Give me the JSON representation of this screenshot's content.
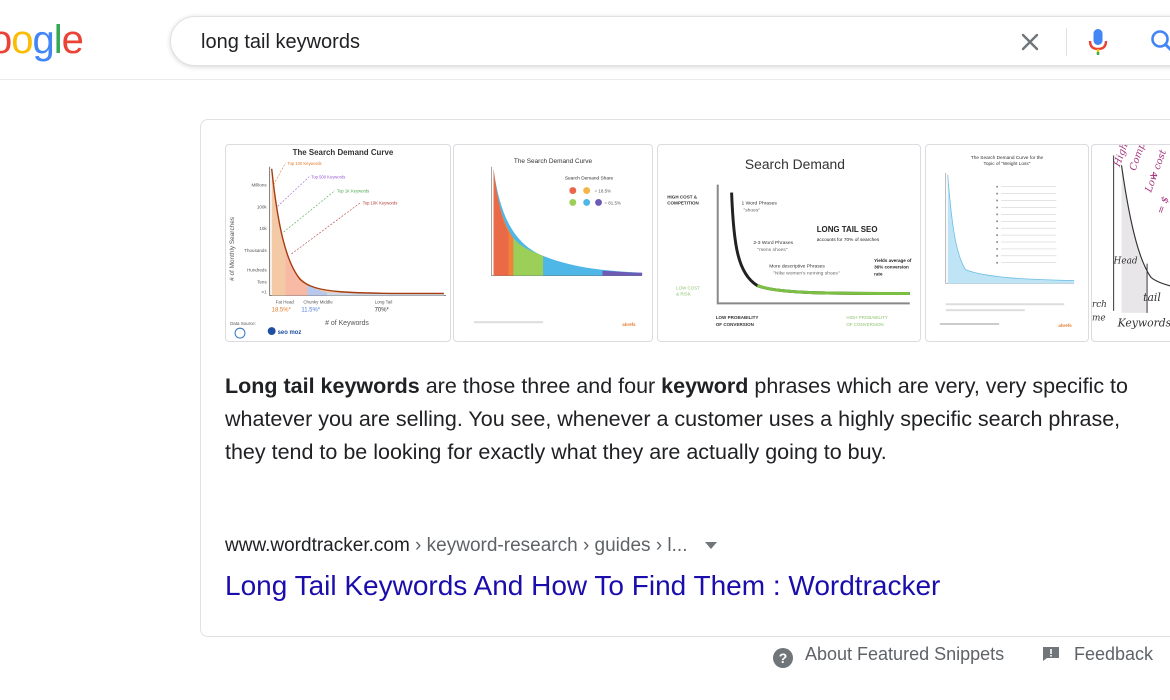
{
  "header": {
    "logo": {
      "letters": [
        "o",
        "o",
        "g",
        "l",
        "e"
      ],
      "colors": [
        "#ea4335",
        "#fbbc05",
        "#4285f4",
        "#34a853",
        "#ea4335"
      ]
    },
    "search": {
      "query": "long tail keywords"
    },
    "icons": {
      "clear": "close-icon",
      "mic": "microphone-icon",
      "search": "search-icon"
    }
  },
  "featured_snippet": {
    "images": [
      {
        "title": "The Search Demand Curve",
        "ylabel": "# of Monthly Searches",
        "xlabel": "# of Keywords",
        "y_ticks": [
          "Millions",
          "100k",
          "10k",
          "Thousands",
          "Hundreds",
          "Tens",
          "<1"
        ],
        "callouts": [
          "Top 100 Keywords",
          "Top 500 Keywords",
          "Top 1K Keywords",
          "Top 10K Keywords"
        ],
        "bottom_groups": [
          "Fat Head",
          "Chunky Middle",
          "Long Tail"
        ],
        "bottom_values": [
          "18.5%*",
          "11.5%*",
          "70%*"
        ],
        "source_label": "Data Source:",
        "logos": [
          "seo moz"
        ]
      },
      {
        "title": "The Search Demand Curve",
        "legend_title": "Search Demand Share",
        "legend_rows": [
          "= 18.5%",
          "= 81.5%"
        ],
        "footer_logo": "ahrefs"
      },
      {
        "title": "Search Demand",
        "left_label_top": [
          "HIGH COST &",
          "COMPETITION"
        ],
        "left_label_bottom": [
          "LOW COST",
          "& RISK"
        ],
        "bottom_left": [
          "LOW PROBABILITY",
          "OF CONVERSION"
        ],
        "bottom_right": [
          "HIGH PROBABILITY",
          "OF CONVERSION"
        ],
        "phrase1": [
          "1 Word Phrases",
          "\"shoes\""
        ],
        "phrase2": [
          "2-3 Word Phrases",
          "\"mens shoes\""
        ],
        "phrase3": [
          "More descriptive Phrases",
          "\"Nike women's running shoes\""
        ],
        "headline": "LONG TAIL SEO",
        "headline_sub": "accounts for 70% of searches",
        "yield": [
          "Yields average of",
          "36% conversion",
          "rate"
        ]
      },
      {
        "title": [
          "The Search Demand Curve for the",
          "Topic of \"Weight Loss\""
        ],
        "footer_logo": "ahrefs"
      },
      {
        "handwriting": [
          "High",
          "Competition",
          "+",
          "Low cost",
          "= $"
        ],
        "labels": [
          "Head",
          "tail",
          "rch",
          "me",
          "Keywords"
        ]
      }
    ],
    "text": {
      "t1": "Long tail keywords",
      "t2": " are those three and four ",
      "t3": "keyword",
      "t4": " phrases which are very, very specific to whatever you are selling. You see, whenever a customer uses a highly specific search phrase, they tend to be looking for exactly what they are actually going to buy."
    },
    "cite": {
      "domain": "www.wordtracker.com",
      "path": " › keyword-research › guides › l...",
      "menu_icon": "caret-down-icon"
    },
    "title": "Long Tail Keywords And How To Find Them : Wordtracker"
  },
  "footer": {
    "about": "About Featured Snippets",
    "about_icon": "help-icon",
    "feedback": "Feedback",
    "feedback_icon": "feedback-icon"
  }
}
